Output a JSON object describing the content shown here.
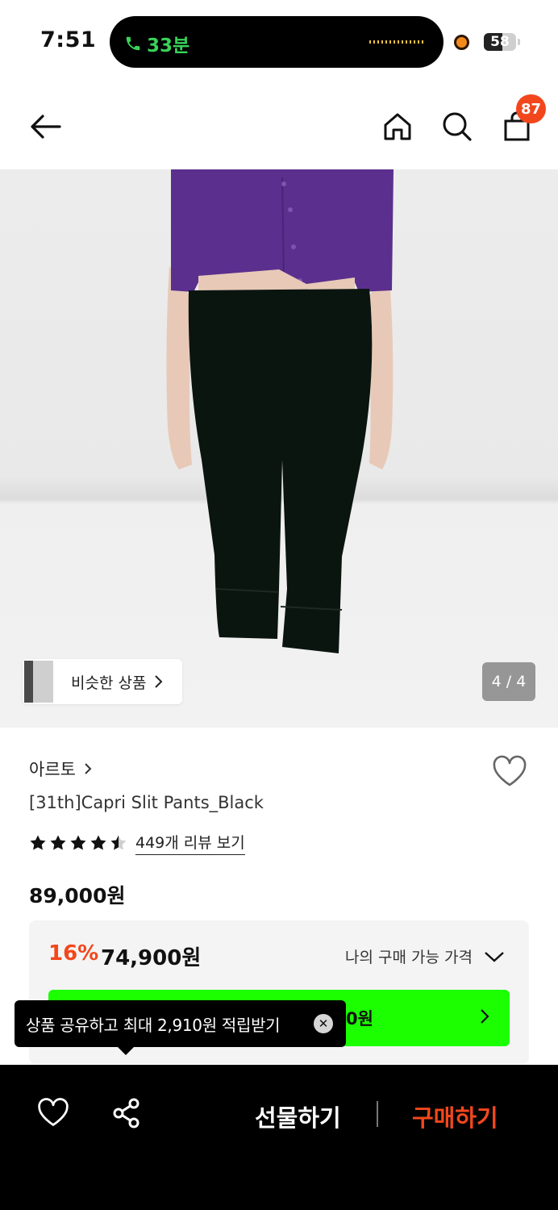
{
  "status_bar": {
    "time": "7:51",
    "call_duration": "33분",
    "battery_level": "58",
    "battery_fraction": 0.58
  },
  "header": {
    "cart_count": "87",
    "icons": [
      "back-arrow-icon",
      "home-icon",
      "search-icon",
      "shopping-bag-icon"
    ]
  },
  "gallery": {
    "similar_label": "비슷한 상품",
    "counter": "4 / 4",
    "current": 4,
    "total": 4
  },
  "product": {
    "brand": "아르토",
    "title": "[31th]Capri Slit Pants_Black",
    "rating": 4.5,
    "reviews_label": "449개 리뷰 보기",
    "original_price": "89,000원"
  },
  "price_box": {
    "discount": "16%",
    "sale_price": "74,900원",
    "my_price_label": "나의 구매 가능 가격",
    "coupon_text_visible": "0원"
  },
  "tooltip": {
    "text": "상품 공유하고 최대 2,910원 적립받기"
  },
  "bottom_bar": {
    "gift_label": "선물하기",
    "buy_label": "구매하기"
  },
  "colors": {
    "accent": "#f2471d",
    "coupon_green": "#1bff00",
    "call_green": "#39d35a"
  }
}
